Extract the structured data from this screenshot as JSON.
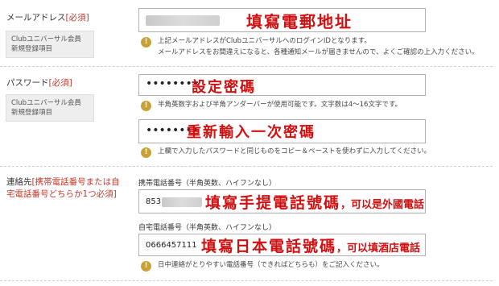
{
  "email": {
    "label": "メールアドレス",
    "required": "[必須]",
    "note_line1": "Clubユニバーサル会員",
    "note_line2": "新規登録項目",
    "annotation": "填寫電郵地址",
    "hint_line1": "上記メールアドレスがClubユニバーサルへのログインIDとなります。",
    "hint_line2": "メールアドレスをお間違えになると、各種通知メールが届きませんので、よくご確認の上入力ください。"
  },
  "password": {
    "label": "パスワード",
    "required": "[必須]",
    "note_line1": "Clubユニバーサル会員",
    "note_line2": "新規登録項目",
    "value": "••••••••",
    "annotation": "設定密碼",
    "hint": "半角英数字および半角アンダーバーが使用可能です。文字数は4～16文字です。",
    "confirm_value": "••••••••",
    "confirm_annotation": "重新輸入一次密碼",
    "confirm_hint": "上欄で入力したパスワードと同じものをコピー＆ペーストを使わずに入力してください。"
  },
  "contact": {
    "label": "連絡先",
    "required_line1": "[携帯電話番号または自",
    "required_line2": "宅電話番号どちらか1つ必須]",
    "mobile_label": "携帯電話番号（半角英数、ハイフンなし）",
    "mobile_value": "853",
    "mobile_annotation_main": "填寫手提電話號碼",
    "mobile_annotation_sub": "，可以是外國電話",
    "home_label": "自宅電話番号（半角英数、ハイフンなし）",
    "home_value": "0666457111",
    "home_annotation_main": "填寫日本電話號碼",
    "home_annotation_sub": "，可以填酒店電話",
    "hint": "日中連絡がとりやすい電話番号（できればどちらも）をご記入ください。"
  },
  "icons": {
    "info": "!"
  },
  "colors": {
    "accent_red": "#d01010",
    "required_red": "#c0392b",
    "info_gold": "#c9a035"
  }
}
